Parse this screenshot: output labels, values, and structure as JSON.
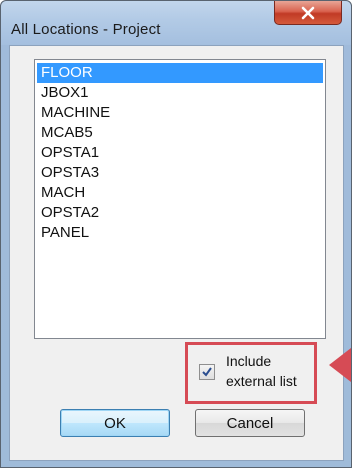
{
  "window": {
    "title": "All Locations - Project",
    "close_icon": "close-x-icon"
  },
  "locations": {
    "items": [
      {
        "label": "FLOOR",
        "selected": true
      },
      {
        "label": "JBOX1",
        "selected": false
      },
      {
        "label": "MACHINE",
        "selected": false
      },
      {
        "label": "MCAB5",
        "selected": false
      },
      {
        "label": "OPSTA1",
        "selected": false
      },
      {
        "label": "OPSTA3",
        "selected": false
      },
      {
        "label": "MACH",
        "selected": false
      },
      {
        "label": "OPSTA2",
        "selected": false
      },
      {
        "label": "PANEL",
        "selected": false
      }
    ]
  },
  "include_external": {
    "label_line1": "Include",
    "label_line2": "external list",
    "checked": true,
    "highlight_color": "#d64b55"
  },
  "buttons": {
    "ok_label": "OK",
    "cancel_label": "Cancel"
  },
  "colors": {
    "selection": "#3399ff",
    "close_button": "#c13a25"
  }
}
